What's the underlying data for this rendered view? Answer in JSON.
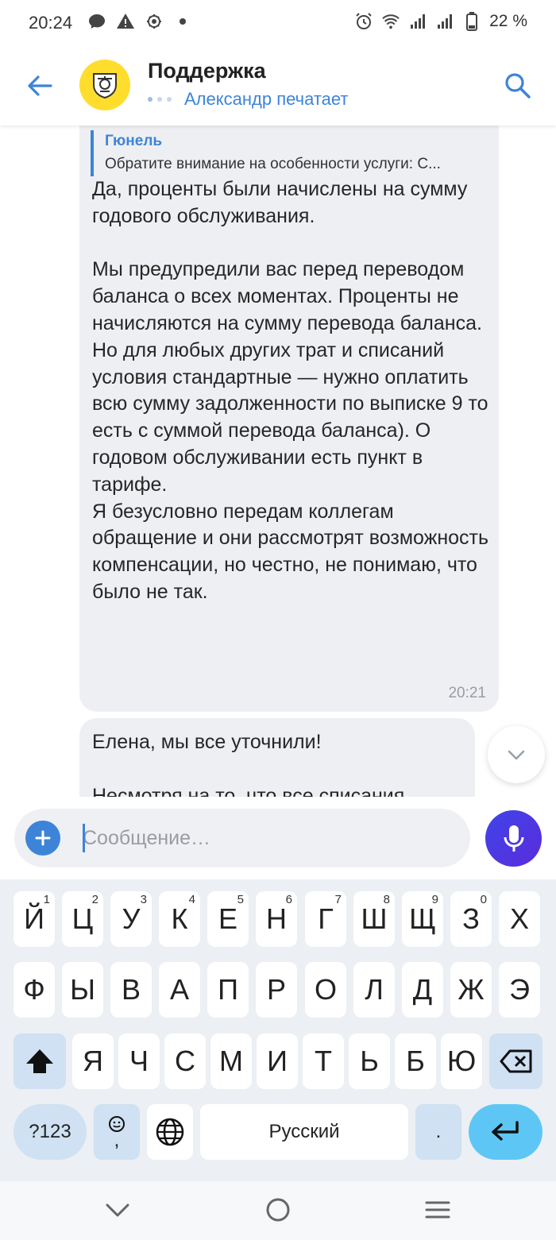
{
  "status_bar": {
    "time": "20:24",
    "battery": "22 %",
    "left_icons": [
      "chat-bubble-icon",
      "warning-icon",
      "bug-icon",
      "dot-icon"
    ],
    "right_icons": [
      "alarm-icon",
      "wifi-icon",
      "signal-icon",
      "signal-icon",
      "battery-icon"
    ]
  },
  "header": {
    "title": "Поддержка",
    "typing_status": "Александр печатает",
    "accent_color": "#3d84d8"
  },
  "messages": [
    {
      "quote_author": "Гюнель",
      "quote_text": "Обратите внимание на особенности услуги: С...",
      "text": "Да, проценты были начислены на сумму годового обслуживания.\n\nМы предупредили вас перед переводом баланса о всех моментах. Проценты не начисляются на сумму перевода баланса. Но для любых других трат и списаний условия стандартные — нужно оплатить всю сумму задолженности по выписке 9 то есть с суммой перевода баланса). О годовом обслуживании есть пункт в тарифе.\nЯ безусловно передам коллегам обращение и они рассмотрят возможность компенсации, но честно, не понимаю, что было не так.",
      "time": "20:21"
    },
    {
      "text": "Елена, мы все уточнили!\n\nНесмотря на то, что все списания"
    }
  ],
  "composer": {
    "placeholder": "Сообщение…"
  },
  "keyboard": {
    "row1": [
      {
        "label": "Й",
        "hint": "1"
      },
      {
        "label": "Ц",
        "hint": "2"
      },
      {
        "label": "У",
        "hint": "3"
      },
      {
        "label": "К",
        "hint": "4"
      },
      {
        "label": "Е",
        "hint": "5"
      },
      {
        "label": "Н",
        "hint": "6"
      },
      {
        "label": "Г",
        "hint": "7"
      },
      {
        "label": "Ш",
        "hint": "8"
      },
      {
        "label": "Щ",
        "hint": "9"
      },
      {
        "label": "З",
        "hint": "0"
      },
      {
        "label": "Х",
        "hint": ""
      }
    ],
    "row2": [
      "Ф",
      "Ы",
      "В",
      "А",
      "П",
      "Р",
      "О",
      "Л",
      "Д",
      "Ж",
      "Э"
    ],
    "row3": [
      "Я",
      "Ч",
      "С",
      "М",
      "И",
      "Т",
      "Ь",
      "Б",
      "Ю"
    ],
    "symbols_key": "?123",
    "comma_key": ",",
    "space_label": "Русский",
    "period_key": "."
  }
}
